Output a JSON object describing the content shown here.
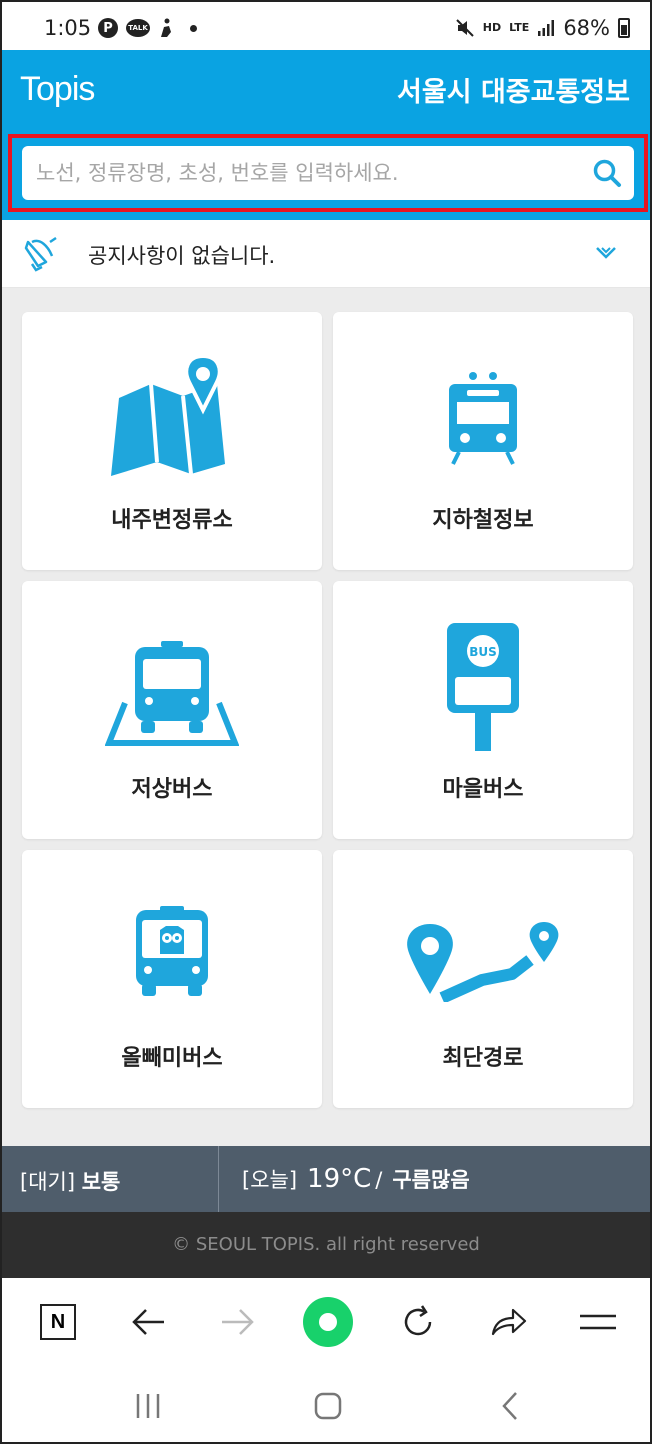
{
  "status_bar": {
    "time": "1:05",
    "battery": "68%",
    "icons": [
      "pinterest-icon",
      "kakaotalk-icon",
      "activity-icon",
      "notification-dot-icon",
      "mute-icon",
      "hd-voice-icon",
      "lte-icon",
      "signal-icon",
      "battery-icon"
    ],
    "talk_label": "TALK",
    "hd_label": "HD",
    "lte_label": "LTE"
  },
  "header": {
    "logo": "Topis",
    "title": "서울시 대중교통정보",
    "accent_color": "#0aa3e2"
  },
  "search": {
    "placeholder": "노선, 정류장명, 초성, 번호를 입력하세요.",
    "value": "",
    "highlight_color": "#e8151f"
  },
  "notice": {
    "text": "공지사항이 없습니다."
  },
  "menu": [
    {
      "label": "내주변정류소",
      "icon": "map-pin-icon"
    },
    {
      "label": "지하철정보",
      "icon": "subway-icon"
    },
    {
      "label": "저상버스",
      "icon": "low-floor-bus-icon"
    },
    {
      "label": "마을버스",
      "icon": "bus-stop-icon"
    },
    {
      "label": "올빼미버스",
      "icon": "owl-bus-icon"
    },
    {
      "label": "최단경로",
      "icon": "route-icon"
    }
  ],
  "menu_badge": "BUS",
  "info": {
    "air_label": "[대기]",
    "air_value": "보통",
    "today_label": "[오늘]",
    "temperature": "19°C",
    "separator": "/",
    "weather": "구름많음"
  },
  "footer": {
    "copyright": "© SEOUL TOPIS. all right reserved"
  },
  "browser_toolbar": {
    "home_label": "N",
    "items": [
      "naver-home-icon",
      "back-arrow-icon",
      "forward-arrow-icon",
      "green-dot-icon",
      "refresh-icon",
      "share-icon",
      "menu-icon"
    ]
  },
  "system_nav": [
    "recent-apps-icon",
    "home-icon",
    "back-icon"
  ]
}
